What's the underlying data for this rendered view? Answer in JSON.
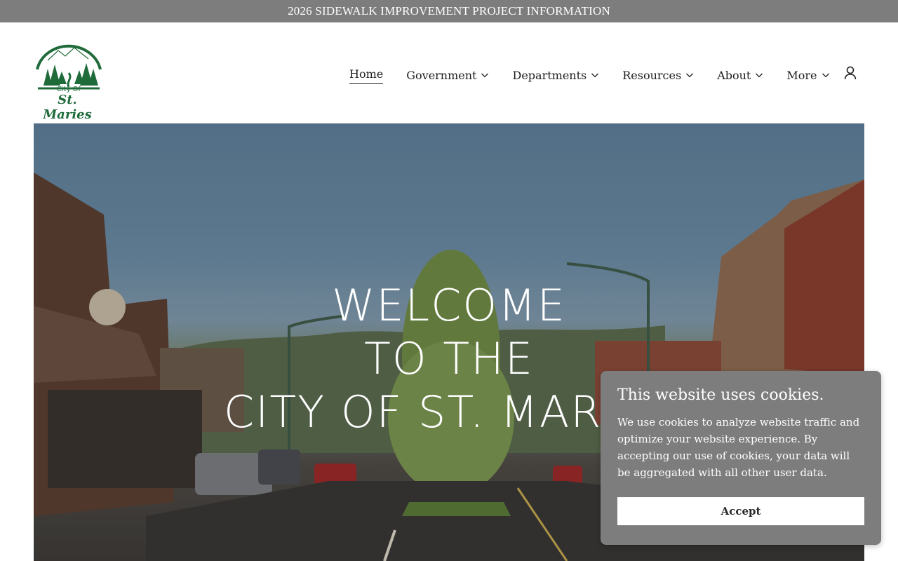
{
  "announcement": {
    "text": "2026 SIDEWALK IMPROVEMENT PROJECT INFORMATION"
  },
  "logo": {
    "line1": "City Of",
    "line2": "St. Maries",
    "color": "#1f6b3a"
  },
  "nav": {
    "items": [
      {
        "label": "Home",
        "active": true,
        "dropdown": false
      },
      {
        "label": "Government",
        "active": false,
        "dropdown": true
      },
      {
        "label": "Departments",
        "active": false,
        "dropdown": true
      },
      {
        "label": "Resources",
        "active": false,
        "dropdown": true
      },
      {
        "label": "About",
        "active": false,
        "dropdown": true
      },
      {
        "label": "More",
        "active": false,
        "dropdown": true
      }
    ],
    "account_icon": "user-icon"
  },
  "hero": {
    "line1": "Welcome",
    "line2": "to the",
    "line3": "City of St. Maries"
  },
  "cookie": {
    "title": "This website uses cookies.",
    "body": "We use cookies to analyze website traffic and optimize your website experience. By accepting our use of cookies, your data will be aggregated with all other user data.",
    "accept_label": "Accept"
  },
  "colors": {
    "announcement_bg": "#7d7d7d",
    "cookie_bg": "#7d7d7d",
    "brand_green": "#1f6b3a"
  }
}
